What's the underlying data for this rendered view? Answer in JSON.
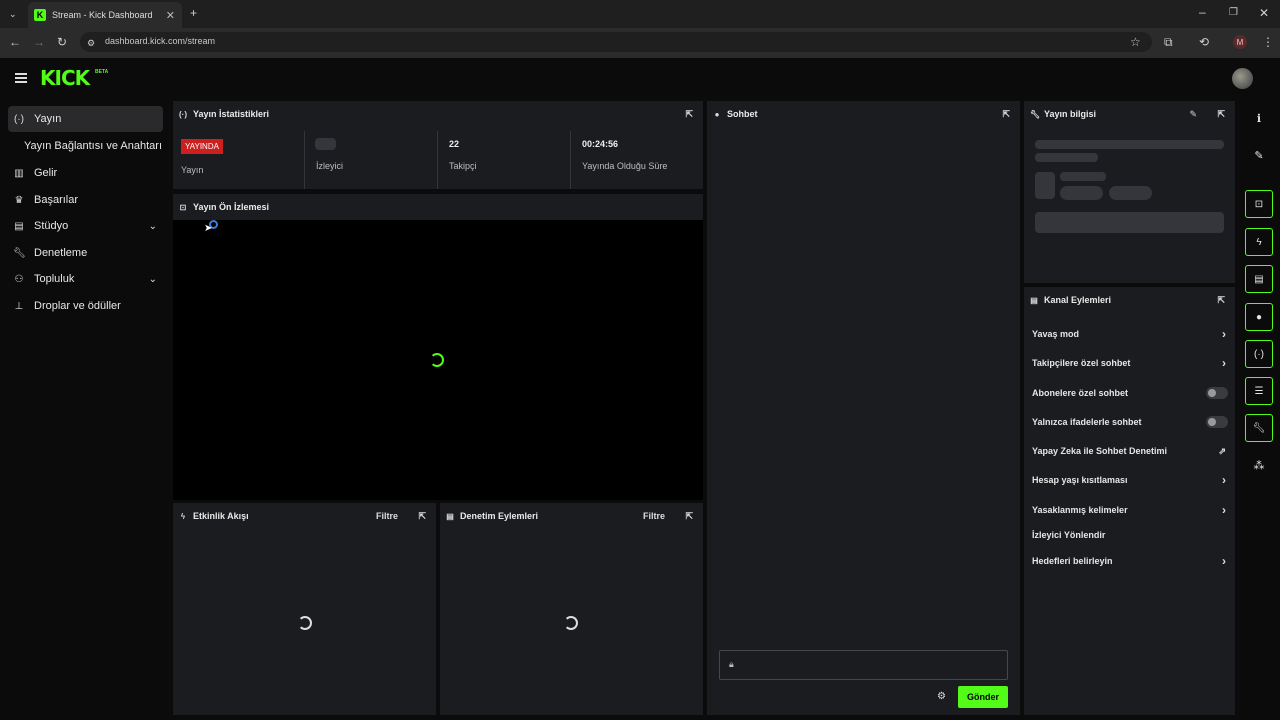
{
  "browser": {
    "tab_title": "Stream - Kick Dashboard",
    "url": "dashboard.kick.com/stream",
    "profile_initial": "M"
  },
  "brand": {
    "logo": "KICK",
    "badge": "BETA"
  },
  "sidebar": {
    "items": [
      {
        "label": "Yayın",
        "icon": "broadcast-icon"
      },
      {
        "label": "Yayın Bağlantısı ve Anahtarı"
      },
      {
        "label": "Gelir",
        "icon": "chart-icon"
      },
      {
        "label": "Başarılar",
        "icon": "trophy-icon"
      },
      {
        "label": "Stüdyo",
        "icon": "studio-icon"
      },
      {
        "label": "Denetleme",
        "icon": "wrench-icon"
      },
      {
        "label": "Topluluk",
        "icon": "community-icon"
      },
      {
        "label": "Droplar ve ödüller",
        "icon": "drops-icon"
      }
    ]
  },
  "stats_panel": {
    "title": "Yayın İstatistikleri",
    "live_badge": "YAYINDA",
    "stats": [
      {
        "value": "",
        "label": "Yayın"
      },
      {
        "value": "",
        "label": "İzleyici"
      },
      {
        "value": "22",
        "label": "Takipçi"
      },
      {
        "value": "00:24:56",
        "label": "Yayında Olduğu Süre"
      }
    ]
  },
  "preview_panel": {
    "title": "Yayın Ön İzlemesi"
  },
  "activity_panel": {
    "title": "Etkinlik Akışı",
    "filter": "Filtre"
  },
  "mod_panel": {
    "title": "Denetim Eylemleri",
    "filter": "Filtre"
  },
  "chat_panel": {
    "title": "Sohbet",
    "send": "Gönder"
  },
  "info_panel": {
    "title": "Yayın bilgisi"
  },
  "actions_panel": {
    "title": "Kanal Eylemleri",
    "rows": [
      {
        "label": "Yavaş mod"
      },
      {
        "label": "Takipçilere özel sohbet"
      },
      {
        "label": "Abonelere özel sohbet"
      },
      {
        "label": "Yalnızca ifadelerle sohbet"
      },
      {
        "label": "Yapay Zeka ile Sohbet Denetimi"
      },
      {
        "label": "Hesap yaşı kısıtlaması"
      },
      {
        "label": "Yasaklanmış kelimeler"
      },
      {
        "label": "İzleyici Yönlendir"
      },
      {
        "label": "Hedefleri belirleyin"
      }
    ]
  },
  "colors": {
    "accent": "#53fc18",
    "live": "#cc1f1f",
    "panel": "#1b1c1f",
    "bg": "#0b0b0c"
  }
}
